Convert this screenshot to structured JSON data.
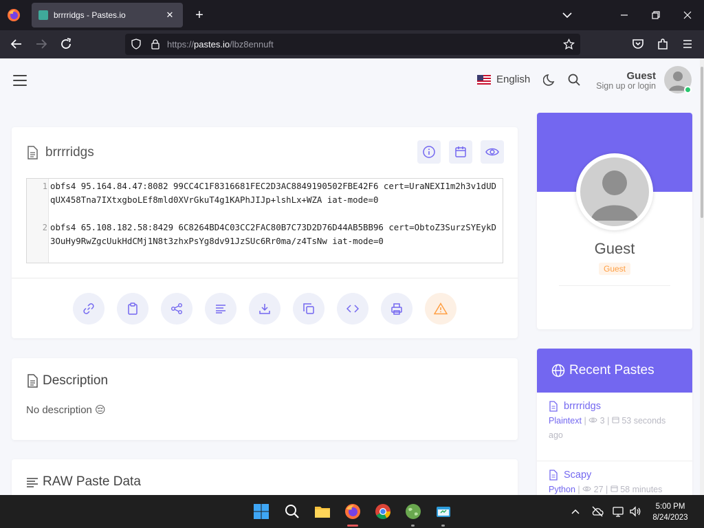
{
  "browser": {
    "tab_title": "brrrridgs - Pastes.io",
    "url_prefix": "https://",
    "url_domain": "pastes.io",
    "url_path": "/lbz8ennuft"
  },
  "header": {
    "language": "English",
    "user_name": "Guest",
    "user_sub": "Sign up or login"
  },
  "paste": {
    "title": "brrrridgs",
    "lines": [
      {
        "no": "1",
        "text": "obfs4 95.164.84.47:8082 99CC4C1F8316681FEC2D3AC8849190502FBE42F6 cert=UraNEXI1m2h3v1dUDqUX458Tna7IXtxgboLEf8mld0XVrGkuT4g1KAPhJIJp+lshLx+WZA iat-mode=0"
      },
      {
        "no": "2",
        "text": "obfs4 65.108.182.58:8429 6C8264BD4C03CC2FAC80B7C73D2D76D44AB5BB96 cert=ObtoZ3SurzSYEykD3OuHy9RwZgcUukHdCMj1N8t3zhxPsYg8dv91JzSUc6Rr0ma/z4TsNw iat-mode=0"
      }
    ]
  },
  "description": {
    "title": "Description",
    "text": "No description 😔"
  },
  "raw": {
    "title": "RAW Paste Data"
  },
  "profile": {
    "name": "Guest",
    "badge": "Guest"
  },
  "recent": {
    "title": "Recent Pastes",
    "items": [
      {
        "title": "brrrridgs",
        "syntax": "Plaintext",
        "views": "3",
        "time": "53 seconds ago"
      },
      {
        "title": "Scapy",
        "syntax": "Python",
        "views": "27",
        "time": "58 minutes"
      }
    ]
  },
  "taskbar": {
    "time": "5:00 PM",
    "date": "8/24/2023"
  },
  "colors": {
    "accent": "#7367f0",
    "warning": "#ff9f43",
    "online": "#28c76f"
  }
}
